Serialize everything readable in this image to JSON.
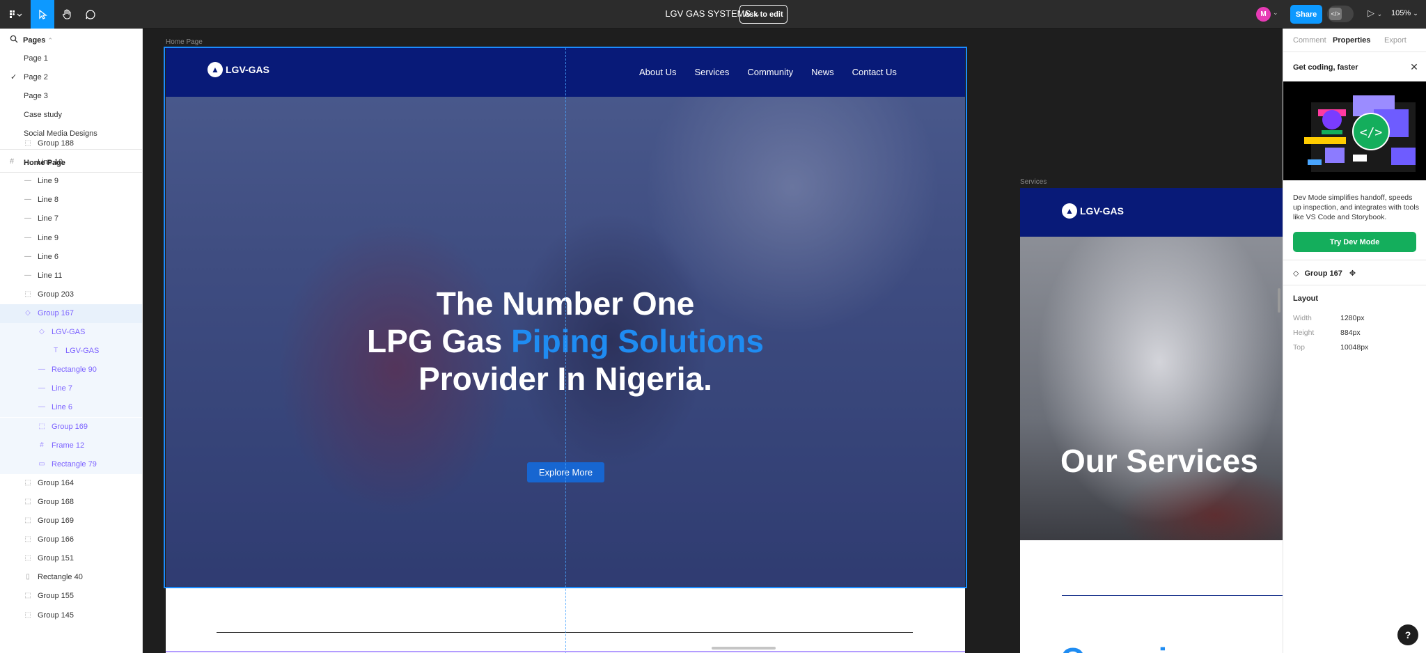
{
  "toolbar": {
    "file_title": "LGV GAS SYSTEMS",
    "ask_to_edit": "Ask to edit",
    "avatar_initial": "M",
    "share": "Share",
    "zoom": "105%",
    "accent_color": "#0d99ff",
    "icons": [
      "figma-menu-icon",
      "move-tool-icon",
      "hand-tool-icon",
      "comment-tool-icon",
      "dev-mode-icon",
      "play-icon"
    ]
  },
  "left_panel": {
    "pages_title": "Pages",
    "pages": [
      {
        "label": "Page 1",
        "selected": false
      },
      {
        "label": "Page 2",
        "selected": true
      },
      {
        "label": "Page 3",
        "selected": false
      },
      {
        "label": "Case study",
        "selected": false
      },
      {
        "label": "Social Media Designs",
        "selected": false
      }
    ],
    "current_frame": "Home Page",
    "layers": [
      {
        "label": "Group 188",
        "icon": "group",
        "indent": 0
      },
      {
        "label": "Line 10",
        "icon": "line",
        "indent": 0
      },
      {
        "label": "Line 9",
        "icon": "line",
        "indent": 0
      },
      {
        "label": "Line 8",
        "icon": "line",
        "indent": 0
      },
      {
        "label": "Line 7",
        "icon": "line",
        "indent": 0
      },
      {
        "label": "Line 9",
        "icon": "line",
        "indent": 0
      },
      {
        "label": "Line 6",
        "icon": "line",
        "indent": 0
      },
      {
        "label": "Line 11",
        "icon": "line",
        "indent": 0
      },
      {
        "label": "Group 203",
        "icon": "group",
        "indent": 0
      },
      {
        "label": "Group 167",
        "icon": "component",
        "indent": 0,
        "selected": true
      },
      {
        "label": "LGV-GAS",
        "icon": "component",
        "indent": 1
      },
      {
        "label": "LGV-GAS",
        "icon": "text",
        "indent": 2
      },
      {
        "label": "Rectangle 90",
        "icon": "line",
        "indent": 1
      },
      {
        "label": "Line 7",
        "icon": "line",
        "indent": 1
      },
      {
        "label": "Line 6",
        "icon": "line",
        "indent": 1
      },
      {
        "label": "Group 169",
        "icon": "group",
        "indent": 1
      },
      {
        "label": "Frame 12",
        "icon": "frame",
        "indent": 1
      },
      {
        "label": "Rectangle 79",
        "icon": "rect",
        "indent": 1
      },
      {
        "label": "Group 164",
        "icon": "group",
        "indent": 0
      },
      {
        "label": "Group 168",
        "icon": "group",
        "indent": 0
      },
      {
        "label": "Group 169",
        "icon": "group",
        "indent": 0
      },
      {
        "label": "Group 166",
        "icon": "group",
        "indent": 0
      },
      {
        "label": "Group 151",
        "icon": "group",
        "indent": 0
      },
      {
        "label": "Rectangle 40",
        "icon": "rect-v",
        "indent": 0
      },
      {
        "label": "Group 155",
        "icon": "group",
        "indent": 0
      },
      {
        "label": "Group 145",
        "icon": "group",
        "indent": 0
      }
    ]
  },
  "canvas": {
    "home_label": "Home Page",
    "services_label": "Services",
    "home": {
      "brand": "LGV-GAS",
      "nav": [
        "About Us",
        "Services",
        "Community",
        "News",
        "Contact Us"
      ],
      "hero_line1": "The Number One",
      "hero_line2_a": "LPG Gas ",
      "hero_line2_b": "Piping Solutions",
      "hero_line3": "Provider In Nigeria.",
      "cta": "Explore More",
      "nav_color": "#081a78",
      "highlight_color": "#1f8cf2"
    },
    "services": {
      "brand": "LGV-GAS",
      "hero_title": "Our Services",
      "section_title": "Our primary"
    }
  },
  "right_panel": {
    "tabs": [
      {
        "label": "Comment",
        "active": false
      },
      {
        "label": "Properties",
        "active": true
      },
      {
        "label": "Export",
        "active": false
      }
    ],
    "promo_title": "Get coding, faster",
    "promo_desc": "Dev Mode simplifies handoff, speeds up inspection, and integrates with tools like VS Code and Storybook.",
    "try_dev_mode": "Try Dev Mode",
    "selection_name": "Group 167",
    "layout_title": "Layout",
    "props": [
      {
        "key": "Width",
        "value": "1280px"
      },
      {
        "key": "Height",
        "value": "884px"
      },
      {
        "key": "Top",
        "value": "10048px"
      }
    ],
    "help": "?"
  }
}
